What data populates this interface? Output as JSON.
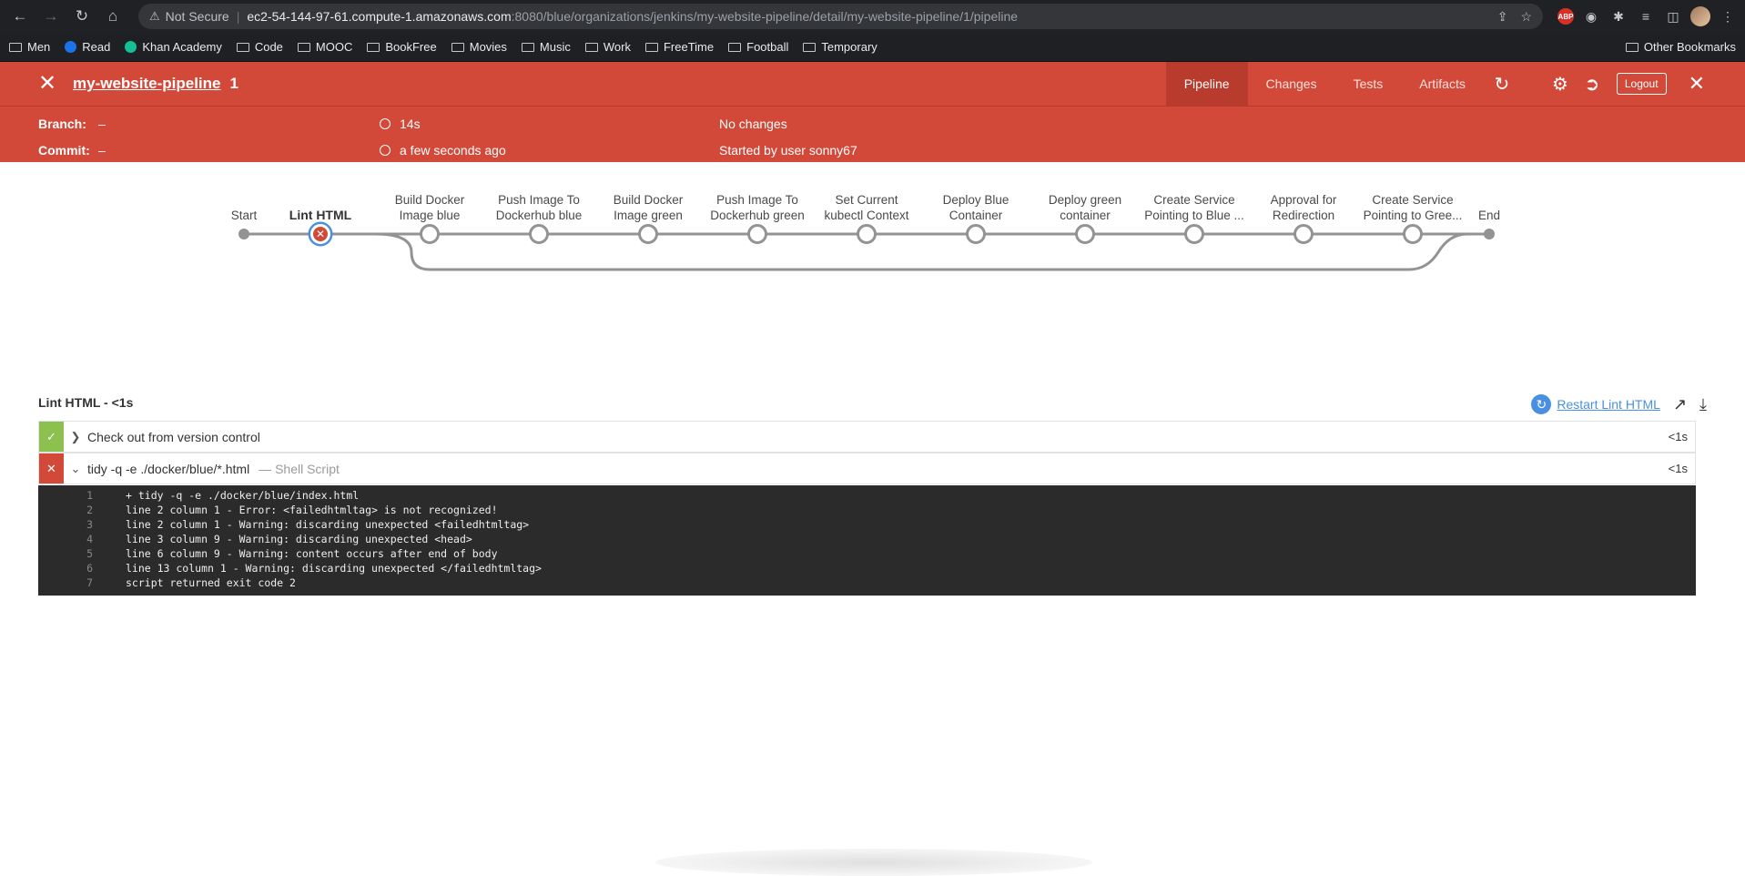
{
  "browser": {
    "not_secure": "Not Secure",
    "url_host": "ec2-54-144-97-61.compute-1.amazonaws.com",
    "url_path": ":8080/blue/organizations/jenkins/my-website-pipeline/detail/my-website-pipeline/1/pipeline",
    "bookmarks": [
      "Men",
      "Read",
      "Khan Academy",
      "Code",
      "MOOC",
      "BookFree",
      "Movies",
      "Music",
      "Work",
      "FreeTime",
      "Football",
      "Temporary"
    ],
    "other_bookmarks": "Other Bookmarks"
  },
  "header": {
    "pipeline_name": "my-website-pipeline",
    "run_number": "1",
    "tabs": [
      "Pipeline",
      "Changes",
      "Tests",
      "Artifacts"
    ],
    "logout": "Logout"
  },
  "summary": {
    "branch_label": "Branch:",
    "branch_value": "–",
    "commit_label": "Commit:",
    "commit_value": "–",
    "duration": "14s",
    "time_ago": "a few seconds ago",
    "changes": "No changes",
    "started_by": "Started by user sonny67"
  },
  "pipeline": {
    "start_label": "Start",
    "end_label": "End",
    "stages": [
      {
        "line1": "Lint HTML",
        "line2": "",
        "status": "failed"
      },
      {
        "line1": "Build Docker",
        "line2": "Image blue",
        "status": "not_built"
      },
      {
        "line1": "Push Image To",
        "line2": "Dockerhub blue",
        "status": "not_built"
      },
      {
        "line1": "Build Docker",
        "line2": "Image green",
        "status": "not_built"
      },
      {
        "line1": "Push Image To",
        "line2": "Dockerhub green",
        "status": "not_built"
      },
      {
        "line1": "Set Current",
        "line2": "kubectl Context",
        "status": "not_built"
      },
      {
        "line1": "Deploy Blue",
        "line2": "Container",
        "status": "not_built"
      },
      {
        "line1": "Deploy green",
        "line2": "container",
        "status": "not_built"
      },
      {
        "line1": "Create Service",
        "line2": "Pointing to Blue ...",
        "status": "not_built"
      },
      {
        "line1": "Approval for",
        "line2": "Redirection",
        "status": "not_built"
      },
      {
        "line1": "Create Service",
        "line2": "Pointing to Gree...",
        "status": "not_built"
      }
    ]
  },
  "log": {
    "title": "Lint HTML - <1s",
    "restart_label": "Restart Lint HTML",
    "steps": [
      {
        "title": "Check out from version control",
        "subtitle": "",
        "duration": "<1s",
        "status": "success",
        "expanded": false
      },
      {
        "title": "tidy -q -e ./docker/blue/*.html",
        "subtitle": "— Shell Script",
        "duration": "<1s",
        "status": "failed",
        "expanded": true
      }
    ],
    "console": [
      "+ tidy -q -e ./docker/blue/index.html",
      "line 2 column 1 - Error: <failedhtmltag> is not recognized!",
      "line 2 column 1 - Warning: discarding unexpected <failedhtmltag>",
      "line 3 column 9 - Warning: discarding unexpected <head>",
      "line 6 column 9 - Warning: content occurs after end of body",
      "line 13 column 1 - Warning: discarding unexpected </failedhtmltag>",
      "script returned exit code 2"
    ]
  },
  "colors": {
    "header_red": "#d24939",
    "success_green": "#8cc04f",
    "link_blue": "#4a90e2"
  }
}
